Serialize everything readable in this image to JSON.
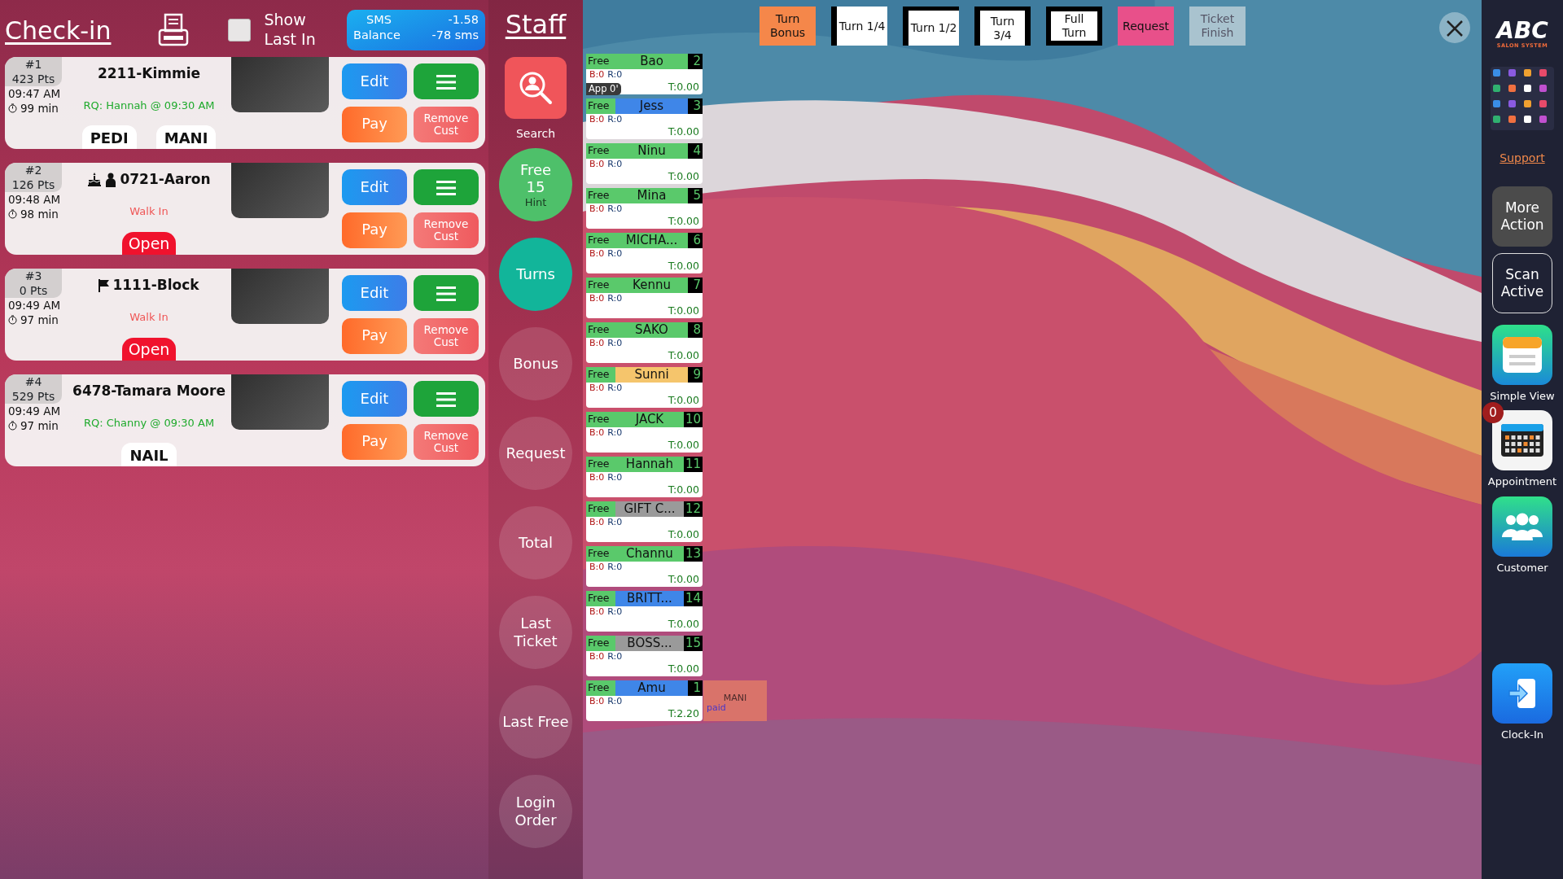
{
  "header": {
    "title": "Check-in",
    "show_last_in": {
      "label": "Show Last In",
      "checked": false
    },
    "sms": {
      "label": "SMS",
      "label2": "Balance",
      "amount": "-1.58",
      "count": "-78 sms"
    }
  },
  "checkins": [
    {
      "number": "#1",
      "points": "423 Pts",
      "time": "09:47 AM",
      "wait": "99 min",
      "name": "2211-Kimmie",
      "note": {
        "text": "RQ: Hannah @ 09:30 AM",
        "color": "#1faa2c"
      },
      "services": [
        "PEDI",
        "MANI"
      ],
      "actions": [
        "Edit",
        "Pay",
        "Remove Cust"
      ]
    },
    {
      "number": "#2",
      "points": "126 Pts",
      "time": "09:48 AM",
      "wait": "98 min",
      "name": "0721-Aaron",
      "birthday": true,
      "new_client": true,
      "note": {
        "text": "Walk In",
        "color": "#ef5656"
      },
      "status": "Open",
      "actions": [
        "Edit",
        "Pay",
        "Remove Cust"
      ]
    },
    {
      "number": "#3",
      "points": "0 Pts",
      "time": "09:49 AM",
      "wait": "97 min",
      "name": "1111-Block",
      "flagged": true,
      "note": {
        "text": "Walk In",
        "color": "#ef5656"
      },
      "status": "Open",
      "actions": [
        "Edit",
        "Pay",
        "Remove Cust"
      ]
    },
    {
      "number": "#4",
      "points": "529 Pts",
      "time": "09:49 AM",
      "wait": "97 min",
      "name": "6478-Tamara Moore",
      "note": {
        "text": "RQ: Channy @ 09:30 AM",
        "color": "#1faa2c"
      },
      "services": [
        "NAIL"
      ],
      "actions": [
        "Edit",
        "Pay",
        "Remove Cust"
      ]
    }
  ],
  "staff_panel": {
    "title": "Staff",
    "buttons": [
      {
        "kind": "search",
        "label": "Search"
      },
      {
        "kind": "free",
        "label": "Free",
        "count": "15",
        "hint": "Hint"
      },
      {
        "kind": "turns",
        "label": "Turns"
      },
      {
        "kind": "plain",
        "label": "Bonus"
      },
      {
        "kind": "plain",
        "label": "Request"
      },
      {
        "kind": "plain",
        "label": "Total"
      },
      {
        "kind": "plain",
        "label": "Last Ticket"
      },
      {
        "kind": "plain",
        "label": "Last Free"
      },
      {
        "kind": "plain",
        "label": "Login Order"
      }
    ]
  },
  "turn_buttons": [
    {
      "kind": "bonus",
      "label": "Turn Bonus"
    },
    {
      "kind": "quarter",
      "label": "Turn 1/4"
    },
    {
      "kind": "half",
      "label": "Turn 1/2"
    },
    {
      "kind": "three_quarter",
      "label": "Turn 3/4"
    },
    {
      "kind": "full",
      "label": "Full Turn"
    },
    {
      "kind": "request",
      "label": "Request"
    },
    {
      "kind": "finish",
      "label": "Ticket Finish"
    }
  ],
  "staff": [
    {
      "status": "Free",
      "name": "Bao",
      "number": "2",
      "color": "#5ac96b",
      "bonus": "B:0",
      "requests": "R:0",
      "total": "T:0.00",
      "appointment": "App 0'"
    },
    {
      "status": "Free",
      "name": "Jess",
      "number": "3",
      "color": "#3f86e8",
      "bonus": "B:0",
      "requests": "R:0",
      "total": "T:0.00"
    },
    {
      "status": "Free",
      "name": "Ninu",
      "number": "4",
      "color": "#5ac96b",
      "bonus": "B:0",
      "requests": "R:0",
      "total": "T:0.00"
    },
    {
      "status": "Free",
      "name": "Mina",
      "number": "5",
      "color": "#5ac96b",
      "bonus": "B:0",
      "requests": "R:0",
      "total": "T:0.00"
    },
    {
      "status": "Free",
      "name": "MICHA...",
      "number": "6",
      "color": "#5ac96b",
      "bonus": "B:0",
      "requests": "R:0",
      "total": "T:0.00"
    },
    {
      "status": "Free",
      "name": "Kennu",
      "number": "7",
      "color": "#5ac96b",
      "bonus": "B:0",
      "requests": "R:0",
      "total": "T:0.00"
    },
    {
      "status": "Free",
      "name": "SAKO",
      "number": "8",
      "color": "#5ac96b",
      "bonus": "B:0",
      "requests": "R:0",
      "total": "T:0.00"
    },
    {
      "status": "Free",
      "name": "Sunni",
      "number": "9",
      "color": "#f5c56c",
      "bonus": "B:0",
      "requests": "R:0",
      "total": "T:0.00"
    },
    {
      "status": "Free",
      "name": "JACK",
      "number": "10",
      "color": "#5ac96b",
      "bonus": "B:0",
      "requests": "R:0",
      "total": "T:0.00"
    },
    {
      "status": "Free",
      "name": "Hannah",
      "number": "11",
      "color": "#5ac96b",
      "bonus": "B:0",
      "requests": "R:0",
      "total": "T:0.00"
    },
    {
      "status": "Free",
      "name": "GIFT C...",
      "number": "12",
      "color": "#9a9a9a",
      "bonus": "B:0",
      "requests": "R:0",
      "total": "T:0.00"
    },
    {
      "status": "Free",
      "name": "Channu",
      "number": "13",
      "color": "#5ac96b",
      "bonus": "B:0",
      "requests": "R:0",
      "total": "T:0.00"
    },
    {
      "status": "Free",
      "name": "BRITT...",
      "number": "14",
      "color": "#3f86e8",
      "bonus": "B:0",
      "requests": "R:0",
      "total": "T:0.00"
    },
    {
      "status": "Free",
      "name": "BOSS...",
      "number": "15",
      "color": "#9a9a9a",
      "bonus": "B:0",
      "requests": "R:0",
      "total": "T:0.00"
    },
    {
      "status": "Free",
      "name": "Amu",
      "number": "1",
      "color": "#3f86e8",
      "bonus": "B:0",
      "requests": "R:0",
      "total": "T:2.20",
      "ticket": {
        "service": "MANI",
        "payment": "paid"
      }
    }
  ],
  "sidebar": {
    "logo": {
      "name": "ABC",
      "tagline": "SALON SYSTEM"
    },
    "support": "Support",
    "buttons": [
      {
        "kind": "more",
        "label": "More Action"
      },
      {
        "kind": "scan",
        "label": "Scan Active"
      }
    ],
    "apps": [
      {
        "kind": "simple_view",
        "label": "Simple View"
      },
      {
        "kind": "appointment",
        "label": "Appointment",
        "count": "0"
      },
      {
        "kind": "customer",
        "label": "Customer"
      },
      {
        "kind": "clock_in",
        "label": "Clock-In"
      }
    ]
  }
}
